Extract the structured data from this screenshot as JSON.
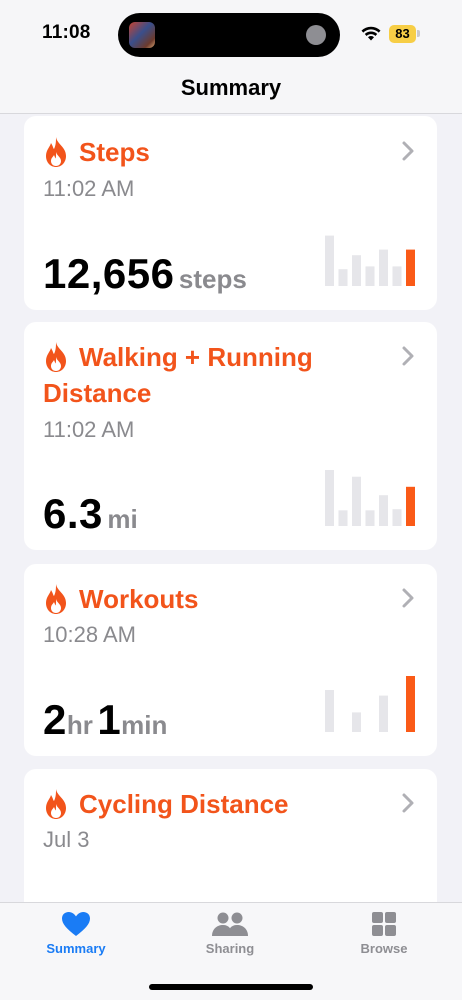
{
  "status_bar": {
    "time": "11:08",
    "battery": "83"
  },
  "nav": {
    "title": "Summary"
  },
  "colors": {
    "accent": "#f2541b",
    "tab_active": "#1a7cf5",
    "tab_inactive": "#8e8e93"
  },
  "cards": [
    {
      "title": "Steps",
      "time": "11:02 AM",
      "value": "12,656",
      "unit": "steps",
      "icon": "flame-icon"
    },
    {
      "title": "Walking + Running Distance",
      "time": "11:02 AM",
      "value": "6.3",
      "unit": "mi",
      "icon": "flame-icon"
    },
    {
      "title": "Workouts",
      "time": "10:28 AM",
      "value_hr": "2",
      "unit_hr": "hr",
      "value_min": "1",
      "unit_min": "min",
      "icon": "flame-icon"
    },
    {
      "title": "Cycling Distance",
      "time": "Jul 3",
      "icon": "flame-icon"
    }
  ],
  "sparklines": [
    {
      "levels": [
        0.9,
        0.3,
        0.55,
        0.35,
        0.65,
        0.35,
        0.65
      ]
    },
    {
      "levels": [
        1.0,
        0.28,
        0.88,
        0.28,
        0.55,
        0.3,
        0.7
      ]
    },
    {
      "levels": [
        0.75,
        0.35,
        0.65,
        1.0
      ]
    }
  ],
  "tabs": [
    {
      "label": "Summary",
      "icon": "heart-icon",
      "active": true
    },
    {
      "label": "Sharing",
      "icon": "people-icon",
      "active": false
    },
    {
      "label": "Browse",
      "icon": "grid-icon",
      "active": false
    }
  ]
}
